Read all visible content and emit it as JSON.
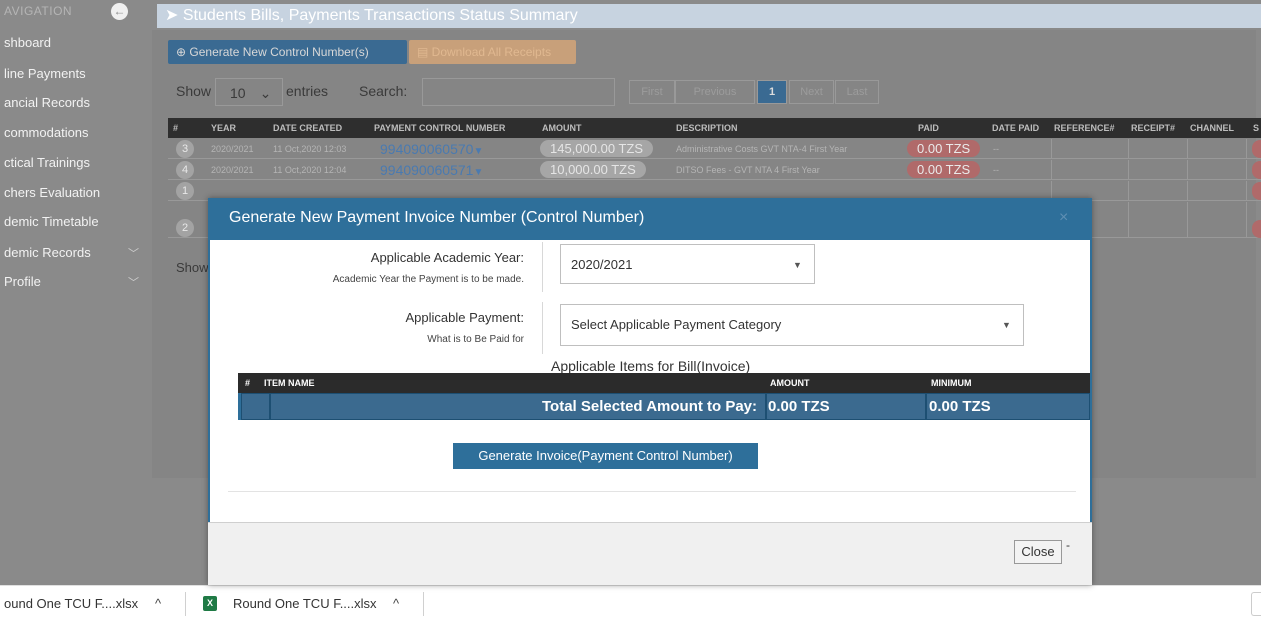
{
  "sidebar": {
    "title": "AVIGATION",
    "toggle_icon": "arrow-left-circle-icon",
    "items": [
      {
        "label": "shboard"
      },
      {
        "label": "line Payments"
      },
      {
        "label": "ancial Records"
      },
      {
        "label": "commodations"
      },
      {
        "label": "ctical Trainings"
      },
      {
        "label": "chers Evaluation"
      },
      {
        "label": "demic Timetable"
      },
      {
        "label": "demic Records",
        "chevron": "﹀"
      },
      {
        "label": " Profile",
        "chevron": "﹀"
      }
    ]
  },
  "panel": {
    "title": "Students Bills, Payments Transactions Status Summary",
    "generate_button": "Generate New Control Number(s)",
    "download_button": "Download All Receipts",
    "show_label": "Show",
    "entries_value": "10",
    "entries_label": "entries",
    "search_label": "Search:",
    "pager": {
      "first": "First",
      "previous": "Previous",
      "current": "1",
      "next": "Next",
      "last": "Last"
    },
    "show_bottom": "Show",
    "columns": [
      "#",
      "YEAR",
      "DATE CREATED",
      "PAYMENT CONTROL NUMBER",
      "AMOUNT",
      "DESCRIPTION",
      "PAID",
      "DATE PAID",
      "REFERENCE#",
      "RECEIPT#",
      "CHANNEL",
      "S"
    ],
    "rows": [
      {
        "num": "3",
        "year": "2020/2021",
        "date": "11 Oct,2020 12:03",
        "control": "994090060570",
        "amount": "145,000.00 TZS",
        "description": "Administrative Costs GVT NTA-4 First Year",
        "paid": "0.00 TZS",
        "date_paid": "--"
      },
      {
        "num": "4",
        "year": "2020/2021",
        "date": "11 Oct,2020 12:04",
        "control": "994090060571",
        "amount": "10,000.00 TZS",
        "description": "DITSO Fees - GVT NTA 4 First Year",
        "paid": "0.00 TZS",
        "date_paid": "--"
      },
      {
        "num": "1"
      },
      {
        "num": "2"
      }
    ]
  },
  "modal": {
    "title": "Generate New Payment Invoice Number (Control Number)",
    "close_x": "×",
    "academic_year": {
      "label": "Applicable Academic Year:",
      "hint": "Academic Year the Payment is to be made.",
      "value": "2020/2021",
      "arrow": "▼"
    },
    "payment": {
      "label": "Applicable Payment:",
      "hint": "What is to Be Paid for",
      "value": "Select Applicable Payment Category",
      "arrow": "▼"
    },
    "items_caption": "Applicable Items for Bill(Invoice)",
    "items_columns": {
      "num": "#",
      "item_name": "ITEM NAME",
      "amount": "AMOUNT",
      "minimum": "MINIMUM"
    },
    "total_label": "Total Selected Amount to Pay:",
    "total_amount": "0.00 TZS",
    "total_minimum": "0.00 TZS",
    "generate_button": "Generate Invoice(Payment Control Number)",
    "close_button": "Close",
    "close_dash": "-"
  },
  "taskbar": {
    "items": [
      {
        "label": "ound One TCU F....xlsx"
      },
      {
        "label": "Round One TCU F....xlsx",
        "icon": "excel-file-icon"
      }
    ],
    "chevron": "^"
  },
  "colors": {
    "modal_blue": "#2e6f9a",
    "paid_badge": "#b06a6a",
    "overlay": "#8a8a8a"
  }
}
